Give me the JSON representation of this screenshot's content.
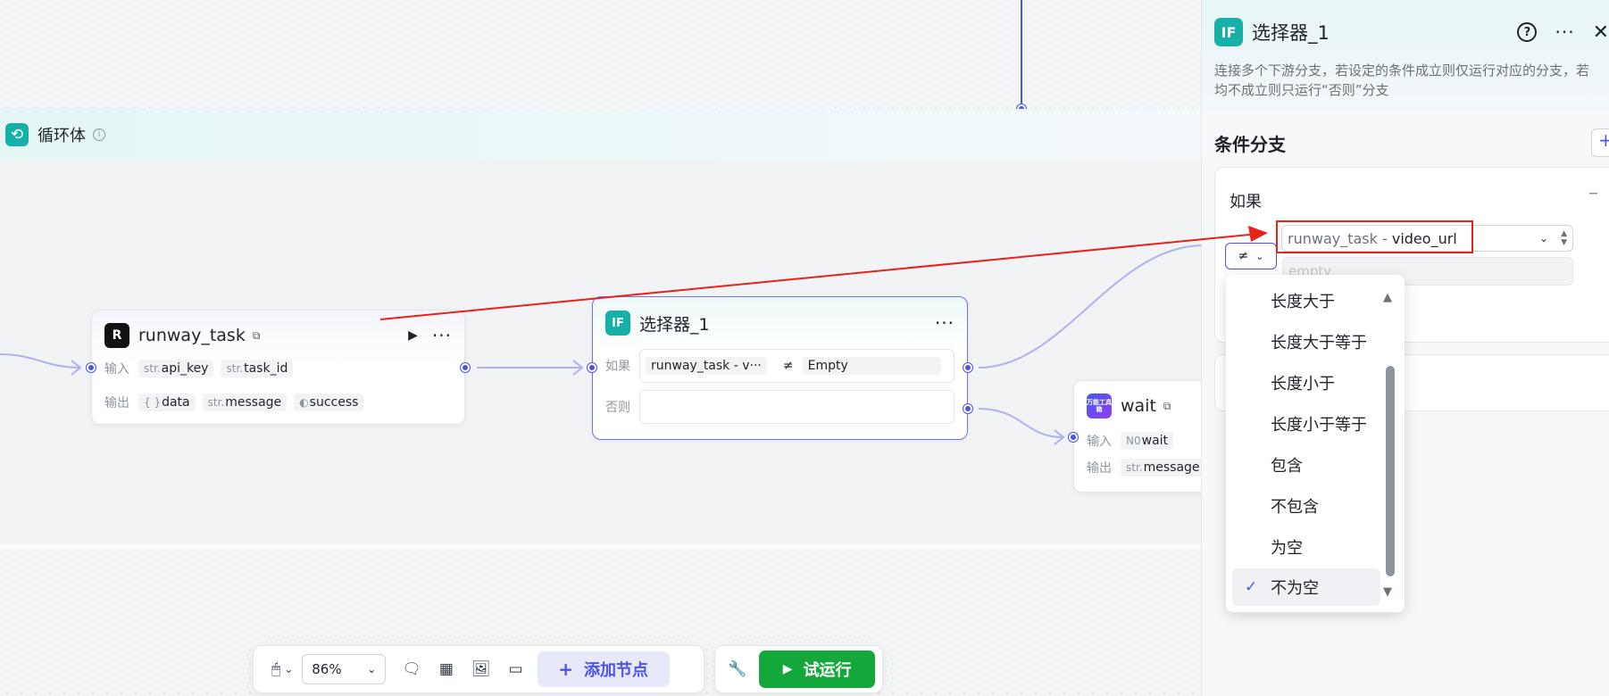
{
  "loop": {
    "title": "循环体",
    "info_icon": "i"
  },
  "runway_node": {
    "icon_text": "R",
    "title": "runway_task",
    "input_label": "输入",
    "output_label": "输出",
    "inputs": [
      {
        "type": "str.",
        "name": "api_key"
      },
      {
        "type": "str.",
        "name": "task_id"
      }
    ],
    "outputs": [
      {
        "type": "{ }",
        "name": "data"
      },
      {
        "type": "str.",
        "name": "message"
      },
      {
        "type": "◐",
        "name": "success"
      }
    ]
  },
  "selector_node": {
    "icon_text": "IF",
    "title": "选择器_1",
    "if_label": "如果",
    "else_label": "否则",
    "cond_left": "runway_task  -  v···",
    "cond_op": "≠",
    "cond_right": "Empty"
  },
  "wait_node": {
    "icon_text": "万能工具箱",
    "title": "wait",
    "input_label": "输入",
    "output_label": "输出",
    "input_type": "N0",
    "input_name": "wait",
    "output_type": "str.",
    "output_name": "message"
  },
  "toolbar": {
    "zoom": "86%",
    "add_node_label": "添加节点",
    "run_label": "试运行"
  },
  "panel": {
    "title": "选择器_1",
    "description_line1": "连接多个下游分支，若设定的条件成立则仅运行对应的分支，若",
    "description_line2": "均不成立则只运行“否则”分支",
    "section_title": "条件分支",
    "if_label": "如果",
    "variable_node": "runway_task",
    "variable_sep": " - ",
    "variable_name": "video_url",
    "operator_symbol": "≠",
    "value_placeholder": "empty"
  },
  "dropdown": {
    "options": [
      "长度大于",
      "长度大于等于",
      "长度小于",
      "长度小于等于",
      "包含",
      "不包含",
      "为空",
      "不为空"
    ],
    "selected": "不为空"
  },
  "colors": {
    "accent": "#4d53e8",
    "run_green": "#14a83b",
    "teal": "#17b0a8",
    "annotation_red": "#e8221b"
  }
}
